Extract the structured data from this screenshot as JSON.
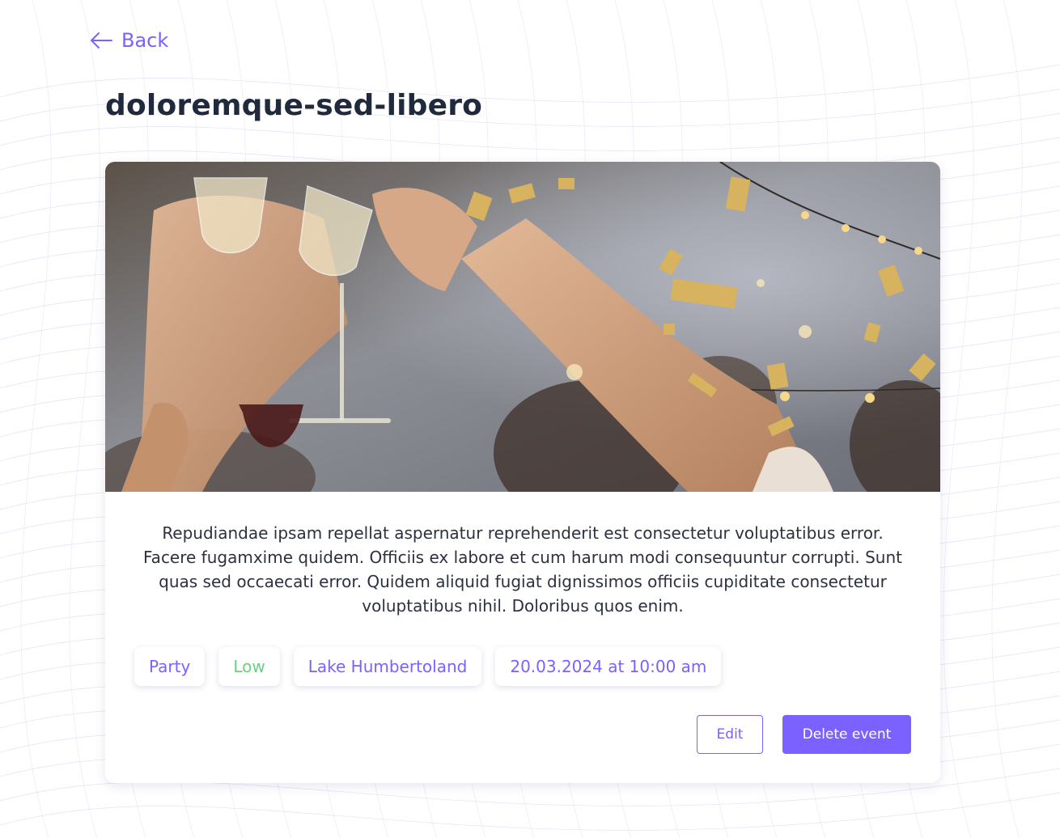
{
  "nav": {
    "back_label": "Back"
  },
  "event": {
    "title": "doloremque-sed-libero",
    "description": "Repudiandae ipsam repellat aspernatur reprehenderit est consectetur voluptatibus error. Facere fugamxime quidem. Officiis ex labore et cum harum modi consequuntur corrupti. Sunt quas sed occaecati error. Quidem aliquid fugiat dignissimos officiis cupiditate consectetur voluptatibus nihil. Doloribus quos enim.",
    "tags": {
      "category": "Party",
      "priority": "Low",
      "location": "Lake Humbertoland",
      "datetime": "20.03.2024 at 10:00 am"
    }
  },
  "actions": {
    "edit_label": "Edit",
    "delete_label": "Delete event"
  },
  "icons": {
    "back": "arrow-left-icon"
  },
  "colors": {
    "accent": "#7b61ff",
    "priority_low": "#6bcf7f",
    "title": "#1f2a3d",
    "text": "#2c3142"
  }
}
